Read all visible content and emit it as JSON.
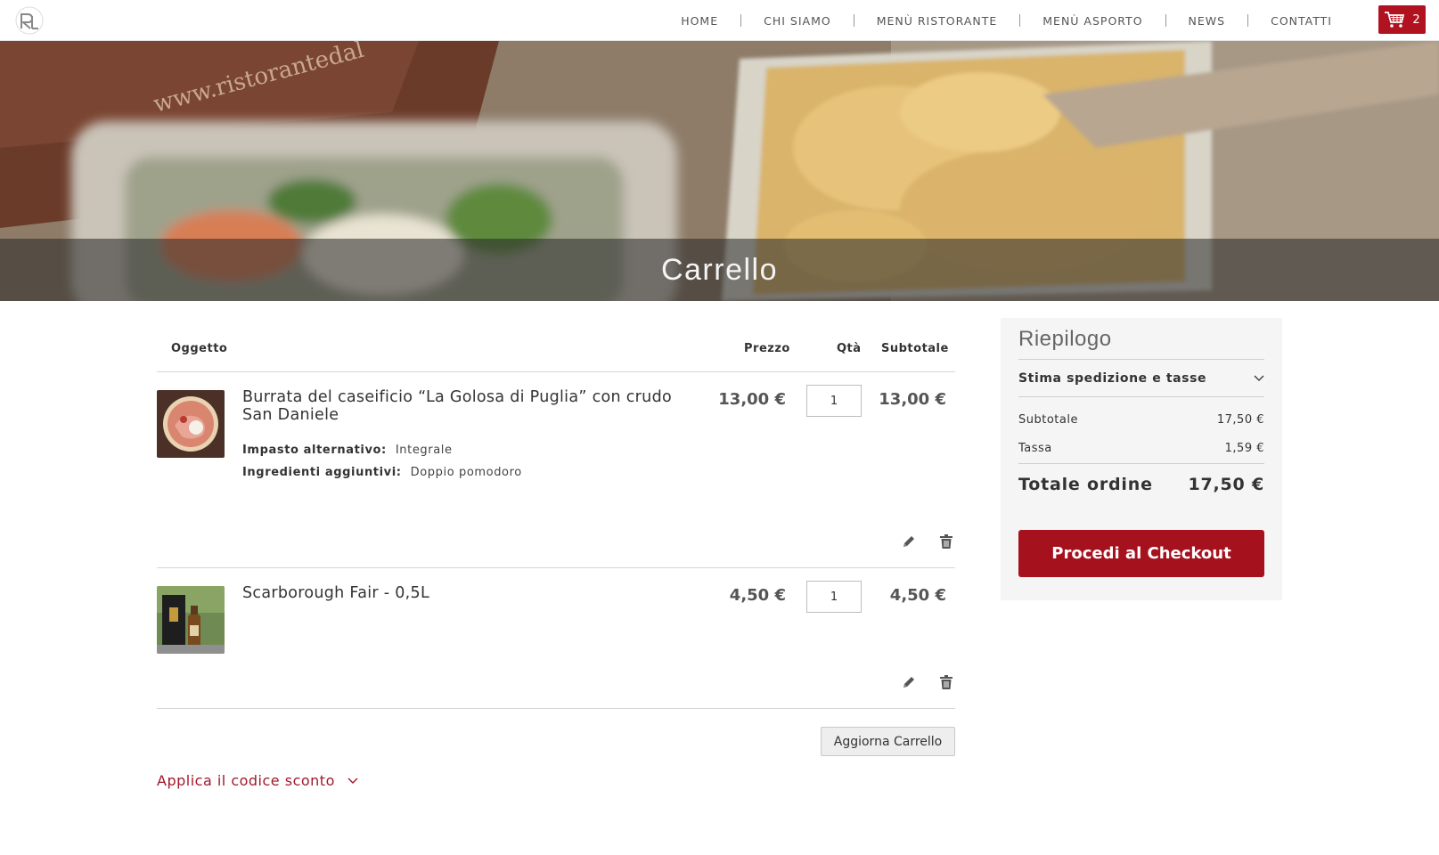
{
  "nav": {
    "items": [
      {
        "label": "HOME"
      },
      {
        "label": "CHI SIAMO"
      },
      {
        "label": "MENÙ RISTORANTE"
      },
      {
        "label": "MENÙ ASPORTO"
      },
      {
        "label": "NEWS"
      },
      {
        "label": "CONTATTI"
      }
    ],
    "cart_count": "2"
  },
  "hero": {
    "title": "Carrello",
    "image_text": "www.ristorantedal"
  },
  "cart": {
    "headers": {
      "item": "Oggetto",
      "price": "Prezzo",
      "qty": "Qtà",
      "subtotal": "Subtotale"
    },
    "items": [
      {
        "name": "Burrata del caseificio “La Golosa di Puglia” con crudo San Daniele",
        "price": "13,00 €",
        "qty": "1",
        "subtotal": "13,00 €",
        "options": [
          {
            "label": "Impasto alternativo:",
            "value": "Integrale"
          },
          {
            "label": "Ingredienti aggiuntivi:",
            "value": "Doppio pomodoro"
          }
        ]
      },
      {
        "name": "Scarborough Fair - 0,5L",
        "price": "4,50 €",
        "qty": "1",
        "subtotal": "4,50 €"
      }
    ],
    "update_label": "Aggiorna Carrello",
    "discount_label": "Applica il codice sconto"
  },
  "summary": {
    "title": "Riepilogo",
    "shipping_label": "Stima spedizione e tasse",
    "subtotal_label": "Subtotale",
    "subtotal_value": "17,50 €",
    "tax_label": "Tassa",
    "tax_value": "1,59 €",
    "total_label": "Totale ordine",
    "total_value": "17,50 €",
    "checkout_label": "Procedi al Checkout"
  },
  "colors": {
    "accent": "#b0131f",
    "link": "#a1182a"
  }
}
